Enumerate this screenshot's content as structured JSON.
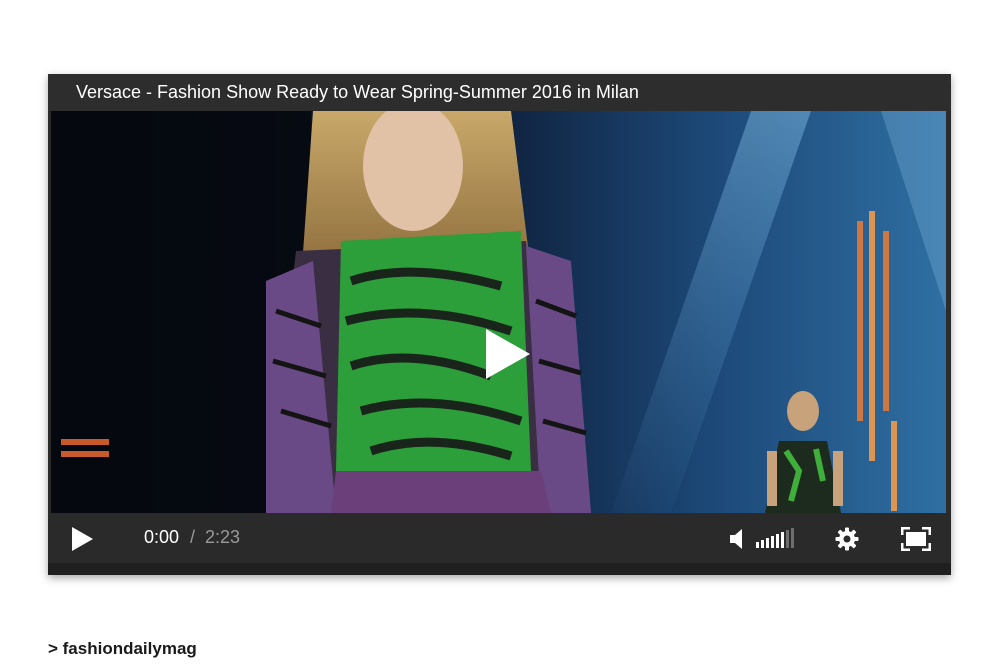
{
  "video": {
    "title": "Versace - Fashion Show Ready to Wear Spring-Summer 2016 in Milan",
    "current_time": "0:00",
    "separator": "/",
    "duration": "2:23",
    "progress": 0,
    "volume_level": 0.8
  },
  "icons": {
    "big_play": "play-icon",
    "play": "play-icon",
    "volume": "speaker-icon",
    "settings": "gear-icon",
    "fullscreen": "fullscreen-icon"
  },
  "source": {
    "label": "> fashiondailymag"
  },
  "colors": {
    "player_bg": "#2b2b2b",
    "text": "#ffffff",
    "muted_text": "#9a9a9a"
  }
}
